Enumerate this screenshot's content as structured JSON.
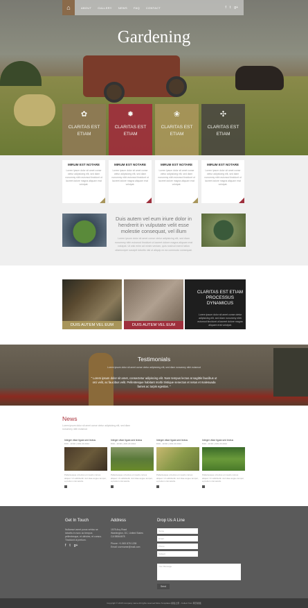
{
  "nav": {
    "items": [
      "ABOUT",
      "GALLERY",
      "NEWS",
      "FAQ",
      "CONTACT"
    ],
    "social": [
      "f",
      "t",
      "g+"
    ]
  },
  "hero": {
    "title": "Gardening",
    "tiles": [
      {
        "label": "CLARITAS EST ETIAM",
        "icon": "leaf-icon",
        "glyph": "✿",
        "color": "#8f7a55"
      },
      {
        "label": "CLARITAS EST ETIAM",
        "icon": "sun-icon",
        "glyph": "✹",
        "color": "#9e2f3c"
      },
      {
        "label": "CLARITAS EST ETIAM",
        "icon": "flower-icon",
        "glyph": "❀",
        "color": "#a8955a"
      },
      {
        "label": "CLARITAS EST ETIAM",
        "icon": "snowflake-icon",
        "glyph": "✣",
        "color": "#4c4a40"
      }
    ]
  },
  "cards": [
    {
      "title": "MIRUM EST NOTARE",
      "text": "Lorem ipsum dolor sit amet conse ctetur adipisicing elit, sed diam nonummy nibh euismod tincidunt ut laoreet dolore magna aliquam erat volutpat.",
      "corner": "#a8955a"
    },
    {
      "title": "MIRUM EST NOTARE",
      "text": "Lorem ipsum dolor sit amet conse ctetur adipisicing elit, sed diam nonummy nibh euismod tincidunt ut laoreet dolore magna aliquam erat volutpat.",
      "corner": "#9e2f3c"
    },
    {
      "title": "MIRUM EST NOTARE",
      "text": "Lorem ipsum dolor sit amet conse ctetur adipisicing elit, sed diam nonummy nibh euismod tincidunt ut laoreet dolore magna aliquam erat volutpat.",
      "corner": "#a8955a"
    },
    {
      "title": "MIRUM EST NOTARE",
      "text": "Lorem ipsum dolor sit amet conse ctetur adipisicing elit, sed diam nonummy nibh euismod tincidunt ut laoreet dolore magna aliquam erat volutpat.",
      "corner": "#9e2f3c"
    }
  ],
  "intro": {
    "heading": "Duis autem vel eum iriure dolor in hendrerit in vulputate velit esse molestie consequat, vel illum",
    "text": "Lorem ipsum dolor sit amet conse ctetur adipisicing elit, sed diam nonummy nibh euismod tincidunt ut laoreet dolore magna aliquam erat volutpat. Ut wisi enim ad minim veniam, quis nostrud exerci tation ullamcorper suscipit lobortis nisl ut aliquip ex ea commodo consequat."
  },
  "gallery": {
    "captions": [
      "DUIS AUTEM VEL EUM",
      "DUIS AUTEM VEL EUM"
    ],
    "dark_heading": "CLARITAS EST ETIAM PROCESSUS DYNAMICUS",
    "dark_text": "Lorem ipsum dolor sit amet conse ctetur adipisicing elit, sed diam nonummy nibh euismod tincidunt ut laoreet dolore magna aliquam erat volutpat."
  },
  "testimonials": {
    "heading": "Testimonials",
    "subtext": "Lorem ipsum dolor sit amet conse ctetur adipisicing elit, sed diam nonummy nibh euismod",
    "quote": "\" Lorem ipsum dolor sit amet, consectetur adipiscing elit. Nam tempus lectus at sagittis faucibus ut orci velit, ac faucibus velit. Pellentesque habitant morbi tristique senectus et netus et malesuada fames ac turpis egestas. \""
  },
  "news": {
    "heading": "News",
    "subtext": "Lorem ipsum dolor sit amet conse ctetur adipisicing elit, sed diam nonummy nibh euismod",
    "items": [
      {
        "title": "Integer vitae ligula sed lectus",
        "date": "8:00 - 10:30 | JUN 23 2014",
        "text": "Pellentesque ut lectus et mauris cursus aliquet. Ut sollicitudin nisl vitae augue tempor, a pretium nisi iaculis.",
        "img": "linear-gradient(135deg,#4a3a2a,#6a5a3a,#3a2e22)"
      },
      {
        "title": "Integer vitae ligula sed lectus",
        "date": "8:00 - 10:30 | JUN 23 2014",
        "text": "Pellentesque ut lectus et mauris cursus aliquet. Ut sollicitudin nisl vitae augue tempor, a pretium nisi iaculis.",
        "img": "linear-gradient(180deg,#8a9a6a,#5a7a3a,#6a8a2a)"
      },
      {
        "title": "Integer vitae ligula sed lectus",
        "date": "8:00 - 10:30 | JUN 23 2014",
        "text": "Pellentesque ut lectus et mauris cursus aliquet. Ut sollicitudin nisl vitae augue tempor, a pretium nisi iaculis.",
        "img": "linear-gradient(135deg,#c8b870,#8a9a4a,#6a7a3a)"
      },
      {
        "title": "Integer vitae ligula sed lectus",
        "date": "8:00 - 10:30 | JUN 23 2014",
        "text": "Pellentesque ut lectus et mauris cursus aliquet. Ut sollicitudin nisl vitae augue tempor, a pretium nisi iaculis.",
        "img": "linear-gradient(180deg,#3a6a2a,#6a9a3a,#4a7a2a)"
      }
    ]
  },
  "footer": {
    "touch_heading": "Get In Touch",
    "touch_text": "Nullamurt amet purus vehicu se lobortis in nunc ac tempus pellentesque, et ultricies, et cursus. Tincidunt ut pretium.",
    "address_heading": "Address",
    "address_lines": [
      "1578 Any Road",
      "Washington, DC, United States",
      "CA 98564678",
      "",
      "Phone: +1 800 878 1238",
      "Email: username@mail.com"
    ],
    "contact_heading": "Drop Us A Line",
    "fields": [
      "Name",
      "Email",
      "Phone",
      "Subject"
    ],
    "message_placeholder": "Your Message",
    "send_label": "Send",
    "copyright": "Copyright © 2015 Company name All rights reserved More Templates 模板之家 - Collect from 网页模板"
  },
  "colors": {
    "accent": "#a8303a",
    "gold": "#a8955a",
    "dark": "#4c4a40"
  }
}
